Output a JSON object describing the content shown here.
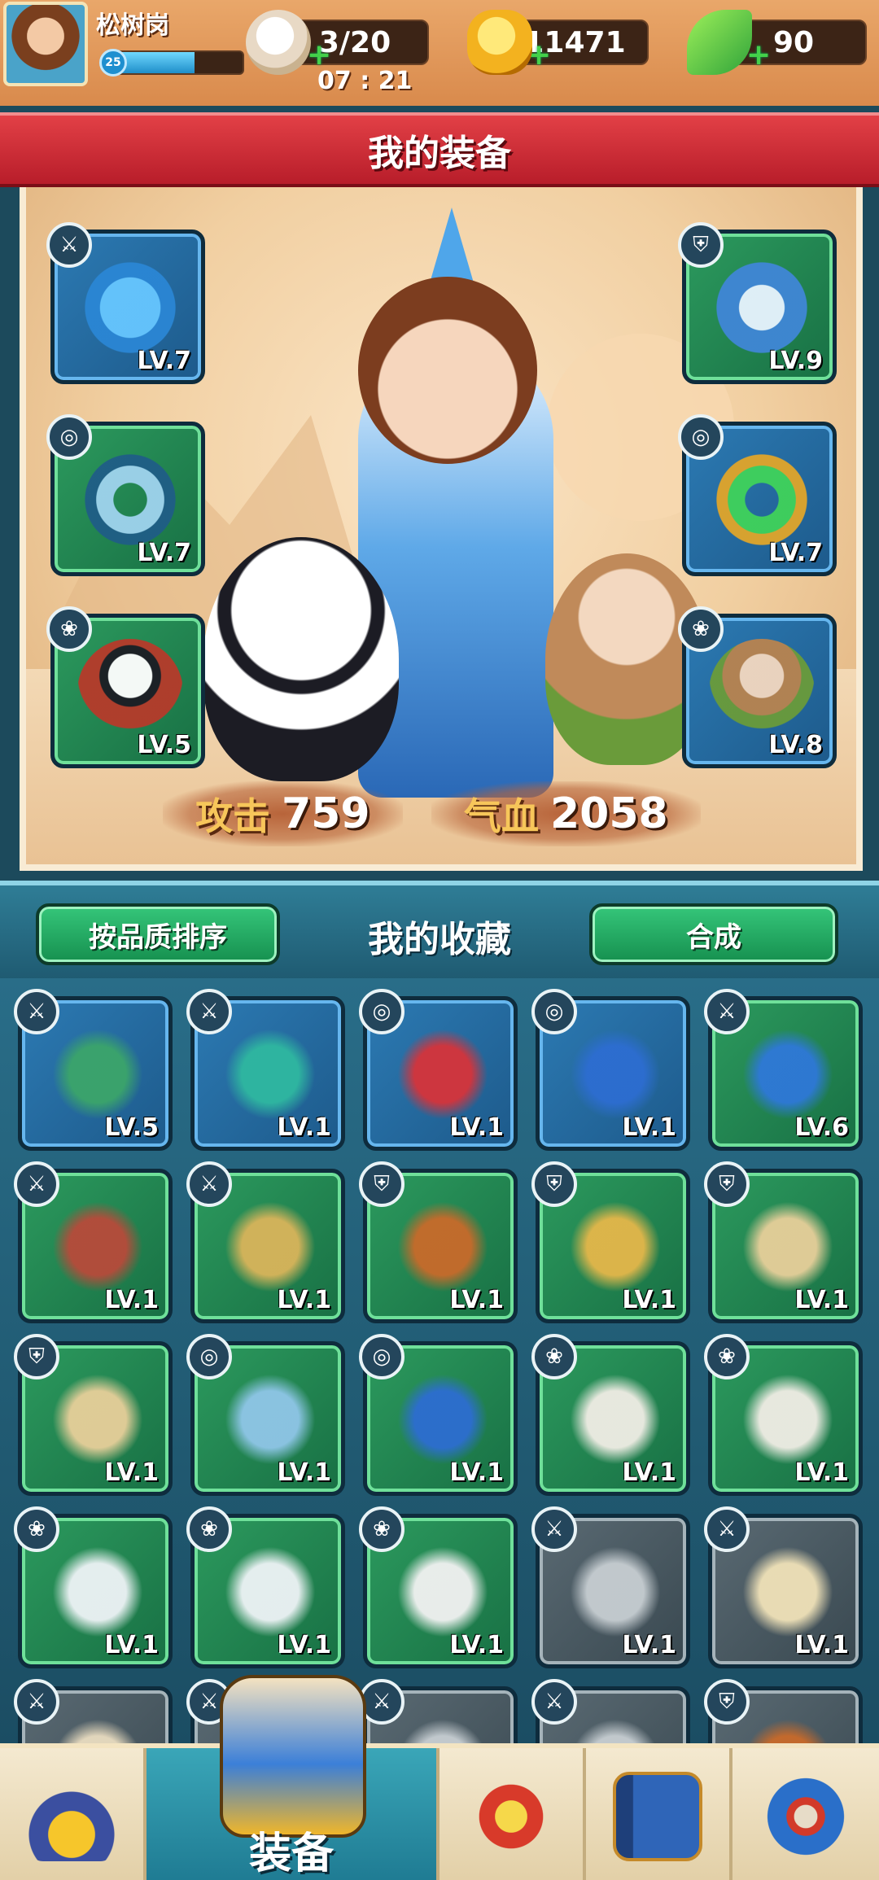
{
  "player": {
    "name": "松树岗",
    "level": "25",
    "xp_progress": 0.62
  },
  "resources": {
    "stamina": {
      "value": "3/20",
      "icon": "bun-icon"
    },
    "gold": {
      "value": "11471",
      "icon": "gold-ingot-icon"
    },
    "jade": {
      "value": "90",
      "icon": "leaf-jade-icon"
    },
    "plus": "+"
  },
  "timer": "07 : 21",
  "equipment_panel": {
    "title": "我的装备",
    "slots": [
      {
        "type_icon": "sword-type-icon",
        "tag": "⚔",
        "item": "blue-fan",
        "level": "LV.7",
        "rarity": "blue"
      },
      {
        "type_icon": "armor-type-icon",
        "tag": "⛨",
        "item": "blue-fur-armor",
        "level": "LV.9",
        "rarity": "green"
      },
      {
        "type_icon": "pendant-type-icon",
        "tag": "◎",
        "item": "jade-pendant",
        "level": "LV.7",
        "rarity": "green"
      },
      {
        "type_icon": "pendant-type-icon",
        "tag": "◎",
        "item": "dragon-pendant",
        "level": "LV.7",
        "rarity": "blue"
      },
      {
        "type_icon": "pet-type-icon",
        "tag": "❀",
        "item": "panda-pet",
        "level": "LV.5",
        "rarity": "green"
      },
      {
        "type_icon": "pet-type-icon",
        "tag": "❀",
        "item": "monkey-pet",
        "level": "LV.8",
        "rarity": "blue"
      }
    ],
    "stats": {
      "attack": {
        "label": "攻击",
        "value": "759"
      },
      "hp": {
        "label": "气血",
        "value": "2058"
      }
    }
  },
  "collection": {
    "title": "我的收藏",
    "sort_button": "按品质排序",
    "combine_button": "合成",
    "items": [
      {
        "tag": "⚔",
        "level": "LV.5",
        "rarity": "blue",
        "color": "#3ba56a"
      },
      {
        "tag": "⚔",
        "level": "LV.1",
        "rarity": "blue",
        "color": "#2fb8a0"
      },
      {
        "tag": "◎",
        "level": "LV.1",
        "rarity": "blue",
        "color": "#d6333a"
      },
      {
        "tag": "◎",
        "level": "LV.1",
        "rarity": "blue",
        "color": "#2d6dd1"
      },
      {
        "tag": "⚔",
        "level": "LV.6",
        "rarity": "green",
        "color": "#2e78d8"
      },
      {
        "tag": "⚔",
        "level": "LV.1",
        "rarity": "green",
        "color": "#b84a3a"
      },
      {
        "tag": "⚔",
        "level": "LV.1",
        "rarity": "green",
        "color": "#d9b45a"
      },
      {
        "tag": "⛨",
        "level": "LV.1",
        "rarity": "green",
        "color": "#c86a2a"
      },
      {
        "tag": "⛨",
        "level": "LV.1",
        "rarity": "green",
        "color": "#e5b74a"
      },
      {
        "tag": "⛨",
        "level": "LV.1",
        "rarity": "green",
        "color": "#e8cf9a"
      },
      {
        "tag": "⛨",
        "level": "LV.1",
        "rarity": "green",
        "color": "#e8cf9a"
      },
      {
        "tag": "◎",
        "level": "LV.1",
        "rarity": "green",
        "color": "#8fc6e8"
      },
      {
        "tag": "◎",
        "level": "LV.1",
        "rarity": "green",
        "color": "#2d6dd1"
      },
      {
        "tag": "❀",
        "level": "LV.1",
        "rarity": "green",
        "color": "#f1ede5"
      },
      {
        "tag": "❀",
        "level": "LV.1",
        "rarity": "green",
        "color": "#f1ede5"
      },
      {
        "tag": "❀",
        "level": "LV.1",
        "rarity": "green",
        "color": "#eef3f6"
      },
      {
        "tag": "❀",
        "level": "LV.1",
        "rarity": "green",
        "color": "#eef3f6"
      },
      {
        "tag": "❀",
        "level": "LV.1",
        "rarity": "green",
        "color": "#f2f2f2"
      },
      {
        "tag": "⚔",
        "level": "LV.1",
        "rarity": "gray",
        "color": "#c7ced2"
      },
      {
        "tag": "⚔",
        "level": "LV.1",
        "rarity": "gray",
        "color": "#f0e2b8"
      },
      {
        "tag": "⚔",
        "level": "",
        "rarity": "gray",
        "color": "#e9dcc0"
      },
      {
        "tag": "⚔",
        "level": "",
        "rarity": "gray",
        "color": "#c7ced2"
      },
      {
        "tag": "⚔",
        "level": "",
        "rarity": "gray",
        "color": "#c7ced2"
      },
      {
        "tag": "⚔",
        "level": "",
        "rarity": "gray",
        "color": "#c7ced2"
      },
      {
        "tag": "⛨",
        "level": "",
        "rarity": "gray",
        "color": "#c86a2a"
      }
    ]
  },
  "navbar": {
    "tabs": [
      {
        "name": "shop-tab",
        "icon": "gold-ingot-shop-icon"
      },
      {
        "name": "equipment-tab",
        "label": "装备",
        "icon": "robe-icon",
        "active": true
      },
      {
        "name": "battle-tab",
        "icon": "sword-burst-icon"
      },
      {
        "name": "book-tab",
        "icon": "book-icon"
      },
      {
        "name": "settings-tab",
        "icon": "gear-icon"
      }
    ]
  }
}
